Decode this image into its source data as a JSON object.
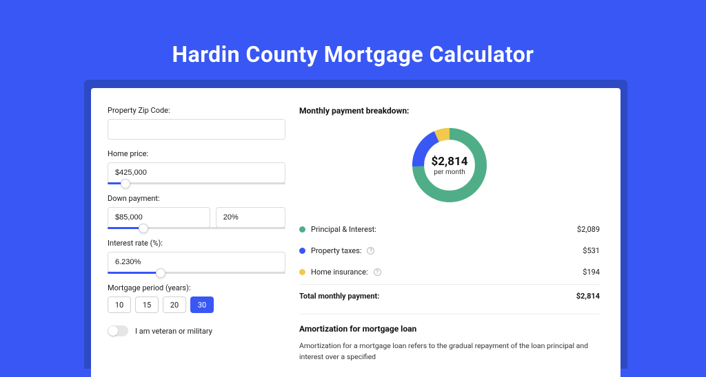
{
  "title": "Hardin County Mortgage Calculator",
  "colors": {
    "accent": "#3857f5",
    "green": "#4fae88",
    "yellow": "#f2c94c"
  },
  "form": {
    "zip": {
      "label": "Property Zip Code:",
      "value": ""
    },
    "home_price": {
      "label": "Home price:",
      "value": "$425,000",
      "slider_pct": 10
    },
    "down_payment": {
      "label": "Down payment:",
      "amount": "$85,000",
      "percent": "20%",
      "slider_pct": 20
    },
    "interest": {
      "label": "Interest rate (%):",
      "value": "6.230%",
      "slider_pct": 30
    },
    "period": {
      "label": "Mortgage period (years):",
      "options": [
        "10",
        "15",
        "20",
        "30"
      ],
      "selected": "30"
    },
    "veteran": {
      "label": "I am veteran or military",
      "on": false
    }
  },
  "breakdown": {
    "title": "Monthly payment breakdown:",
    "donut": {
      "value": "$2,814",
      "sub": "per month",
      "segments": [
        {
          "name": "principal_interest",
          "color": "#4fae88",
          "fraction": 0.742
        },
        {
          "name": "property_taxes",
          "color": "#3857f5",
          "fraction": 0.189
        },
        {
          "name": "home_insurance",
          "color": "#f2c94c",
          "fraction": 0.069
        }
      ]
    },
    "items": [
      {
        "label": "Principal & Interest:",
        "value": "$2,089",
        "color": "green",
        "info": false
      },
      {
        "label": "Property taxes:",
        "value": "$531",
        "color": "blue",
        "info": true
      },
      {
        "label": "Home insurance:",
        "value": "$194",
        "color": "yellow",
        "info": true
      }
    ],
    "total": {
      "label": "Total monthly payment:",
      "value": "$2,814"
    }
  },
  "amortization": {
    "title": "Amortization for mortgage loan",
    "text": "Amortization for a mortgage loan refers to the gradual repayment of the loan principal and interest over a specified"
  },
  "chart_data": {
    "type": "pie",
    "title": "Monthly payment breakdown",
    "categories": [
      "Principal & Interest",
      "Property taxes",
      "Home insurance"
    ],
    "values": [
      2089,
      531,
      194
    ],
    "total": 2814,
    "colors": [
      "#4fae88",
      "#3857f5",
      "#f2c94c"
    ]
  }
}
